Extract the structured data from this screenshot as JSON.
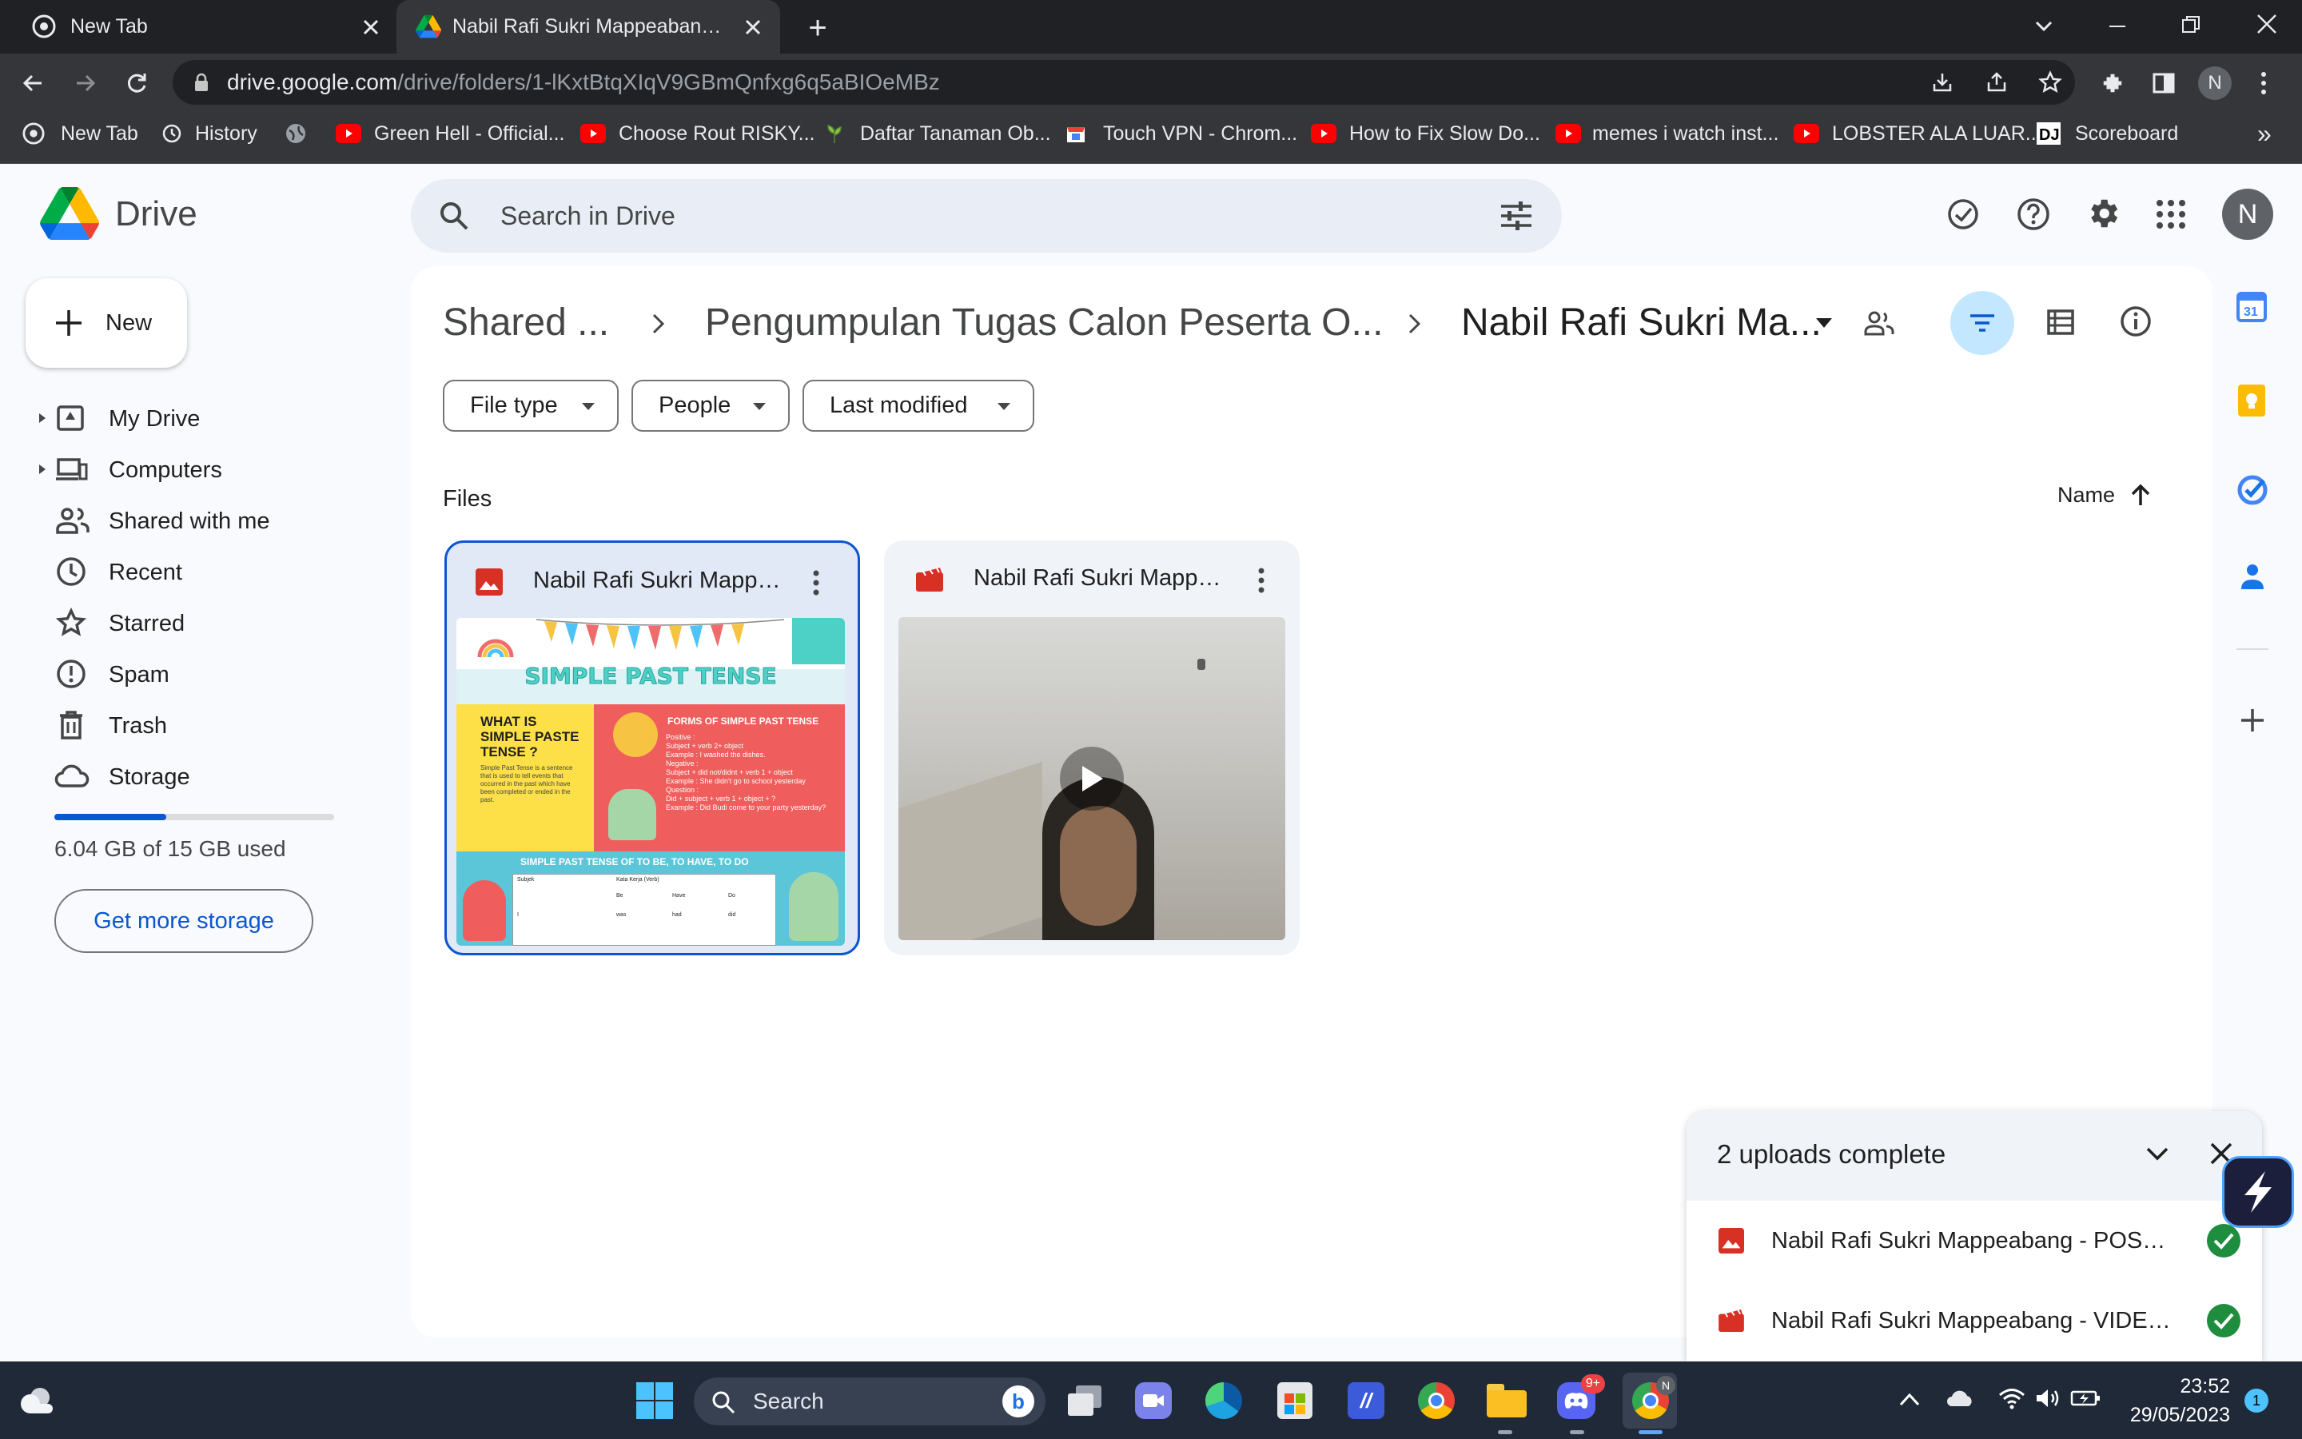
{
  "browser": {
    "tabs": [
      {
        "title": "New Tab",
        "active": false
      },
      {
        "title": "Nabil Rafi Sukri Mappeabang - Go",
        "active": true
      }
    ],
    "new_tab_symbol": "+",
    "url_domain": "drive.google.com",
    "url_path": "/drive/folders/1-lKxtBtqXIqV9GBmQnfxg6q5aBIOeMBz",
    "profile_initial": "N",
    "bookmarks": [
      {
        "label": "New Tab",
        "icon": "chrome-icon"
      },
      {
        "label": "History",
        "icon": "history-icon"
      },
      {
        "label": "",
        "icon": "globe-icon"
      },
      {
        "label": "Green Hell - Official...",
        "icon": "youtube-icon"
      },
      {
        "label": "Choose Rout RISKY...",
        "icon": "youtube-icon"
      },
      {
        "label": "Daftar Tanaman Ob...",
        "icon": "plant-icon"
      },
      {
        "label": "Touch VPN - Chrom...",
        "icon": "store-icon"
      },
      {
        "label": "How to Fix Slow Do...",
        "icon": "youtube-icon"
      },
      {
        "label": "memes i watch inst...",
        "icon": "youtube-icon"
      },
      {
        "label": "LOBSTER ALA LUAR...",
        "icon": "youtube-icon"
      },
      {
        "label": "Scoreboard",
        "icon": "dj-icon"
      }
    ],
    "more_bookmarks": "»"
  },
  "drive": {
    "product_name": "Drive",
    "search_placeholder": "Search in Drive",
    "new_button_label": "New",
    "account_initial": "N",
    "nav": [
      {
        "label": "My Drive",
        "icon": "my-drive-icon",
        "expandable": true
      },
      {
        "label": "Computers",
        "icon": "computers-icon",
        "expandable": true
      },
      {
        "label": "Shared with me",
        "icon": "people-icon",
        "expandable": false
      },
      {
        "label": "Recent",
        "icon": "clock-icon",
        "expandable": false
      },
      {
        "label": "Starred",
        "icon": "star-icon",
        "expandable": false
      },
      {
        "label": "Spam",
        "icon": "spam-icon",
        "expandable": false
      },
      {
        "label": "Trash",
        "icon": "trash-icon",
        "expandable": false
      },
      {
        "label": "Storage",
        "icon": "cloud-icon",
        "expandable": false
      }
    ],
    "storage": {
      "used_text": "6.04 GB of 15 GB used",
      "fraction_used": 0.4,
      "cta": "Get more storage"
    },
    "breadcrumb": [
      "Shared ...",
      "Pengumpulan Tugas Calon Peserta O...",
      "Nabil Rafi Sukri Ma..."
    ],
    "filters": [
      "File type",
      "People",
      "Last modified"
    ],
    "section_label": "Files",
    "sort_label": "Name",
    "files": [
      {
        "name": "Nabil Rafi Sukri Mappe...",
        "type": "image",
        "selected": true
      },
      {
        "name": "Nabil Rafi Sukri Mappe...",
        "type": "video",
        "selected": false
      }
    ],
    "poster": {
      "title": "SIMPLE PAST TENSE",
      "q_heading": "WHAT IS SIMPLE PASTE TENSE ?",
      "q_body": "Simple Past Tense is a sentence that is used to tell events that occurred in the past which have been completed or ended in the past.",
      "forms_heading": "FORMS OF SIMPLE PAST TENSE",
      "forms_lines": [
        "Positive :",
        "Subject + verb 2+ object",
        "Example : I washed the dishes.",
        "Negative :",
        "Subject + did not/didnt + verb 1 + object",
        "Example : She didn't go to school yesterday",
        "Question :",
        "Did + subject + verb 1 + object + ?",
        "Example : Did Budi come to your party yesterday?"
      ],
      "table_heading": "SIMPLE PAST TENSE OF TO BE, TO HAVE, TO DO",
      "table_cols": [
        "Subjek",
        "Kata Kerja (Verb)",
        "Be",
        "Have",
        "Do"
      ],
      "table_row": [
        "I",
        "was",
        "had",
        "did"
      ]
    },
    "upload_panel": {
      "title": "2 uploads complete",
      "items": [
        {
          "name": "Nabil Rafi Sukri Mappeabang - POSTE...",
          "type": "image"
        },
        {
          "name": "Nabil Rafi Sukri Mappeabang - VIDEO...",
          "type": "video"
        }
      ]
    }
  },
  "taskbar": {
    "search_label": "Search",
    "clock_time": "23:52",
    "clock_date": "29/05/2023",
    "notification_count": "1",
    "discord_badge": "9+"
  },
  "colors": {
    "accent_blue": "#0b57d0",
    "selected_blue": "#c2e7ff",
    "drive_bg": "#f8fafd",
    "chrome_dark": "#202124",
    "chrome_toolbar": "#35363a",
    "file_red": "#d93025",
    "check_green": "#1e8e3e"
  }
}
